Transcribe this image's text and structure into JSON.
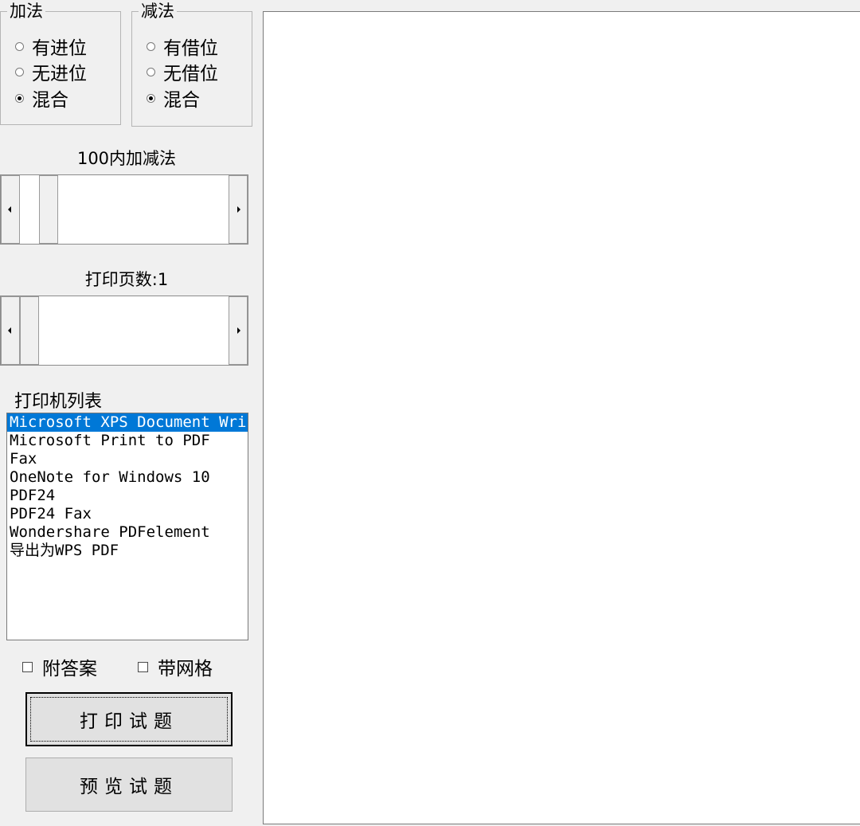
{
  "addition": {
    "title": "加法",
    "options": [
      {
        "label": "有进位",
        "checked": false
      },
      {
        "label": "无进位",
        "checked": false
      },
      {
        "label": "混合",
        "checked": true
      }
    ]
  },
  "subtraction": {
    "title": "减法",
    "options": [
      {
        "label": "有借位",
        "checked": false
      },
      {
        "label": "无借位",
        "checked": false
      },
      {
        "label": "混合",
        "checked": true
      }
    ]
  },
  "range_label": "100内加减法",
  "pages_label": "打印页数:1",
  "printer_list": {
    "label": "打印机列表",
    "items": [
      "Microsoft XPS Document Wri",
      "Microsoft Print to PDF",
      "Fax",
      "OneNote for Windows 10",
      "PDF24",
      "PDF24 Fax",
      "Wondershare PDFelement",
      "导出为WPS PDF"
    ],
    "selected_index": 0
  },
  "checkboxes": {
    "answers": "附答案",
    "grid": "带网格"
  },
  "buttons": {
    "print": "打印试题",
    "preview": "预览试题"
  }
}
